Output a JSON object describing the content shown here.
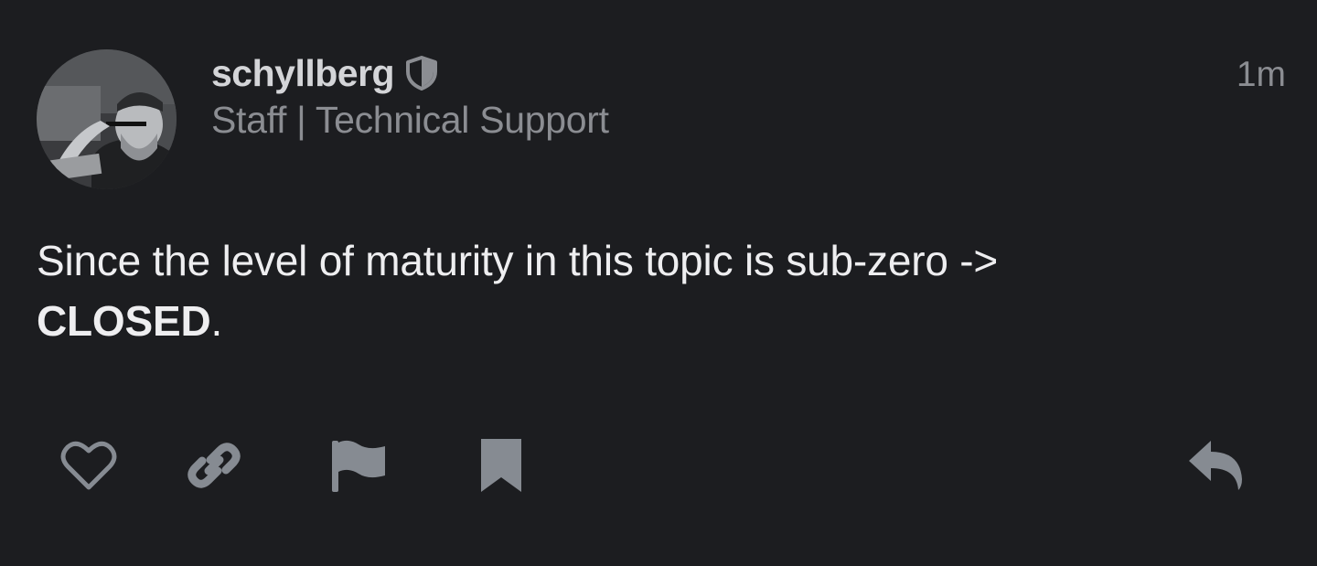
{
  "post": {
    "username": "schyllberg",
    "user_title": "Staff | Technical Support",
    "timestamp": "1m",
    "body_text": "Since the level of maturity in this topic is sub-zero ->",
    "body_emphasis": "CLOSED",
    "body_suffix": "."
  },
  "actions": {
    "like_icon": "heart-icon",
    "link_icon": "link-icon",
    "flag_icon": "flag-icon",
    "bookmark_icon": "bookmark-icon",
    "reply_icon": "reply-icon"
  },
  "colors": {
    "background": "#1c1d20",
    "username": "#d4d5d8",
    "muted": "#8b8d92",
    "body": "#eeeef0",
    "icon": "#868b92"
  }
}
